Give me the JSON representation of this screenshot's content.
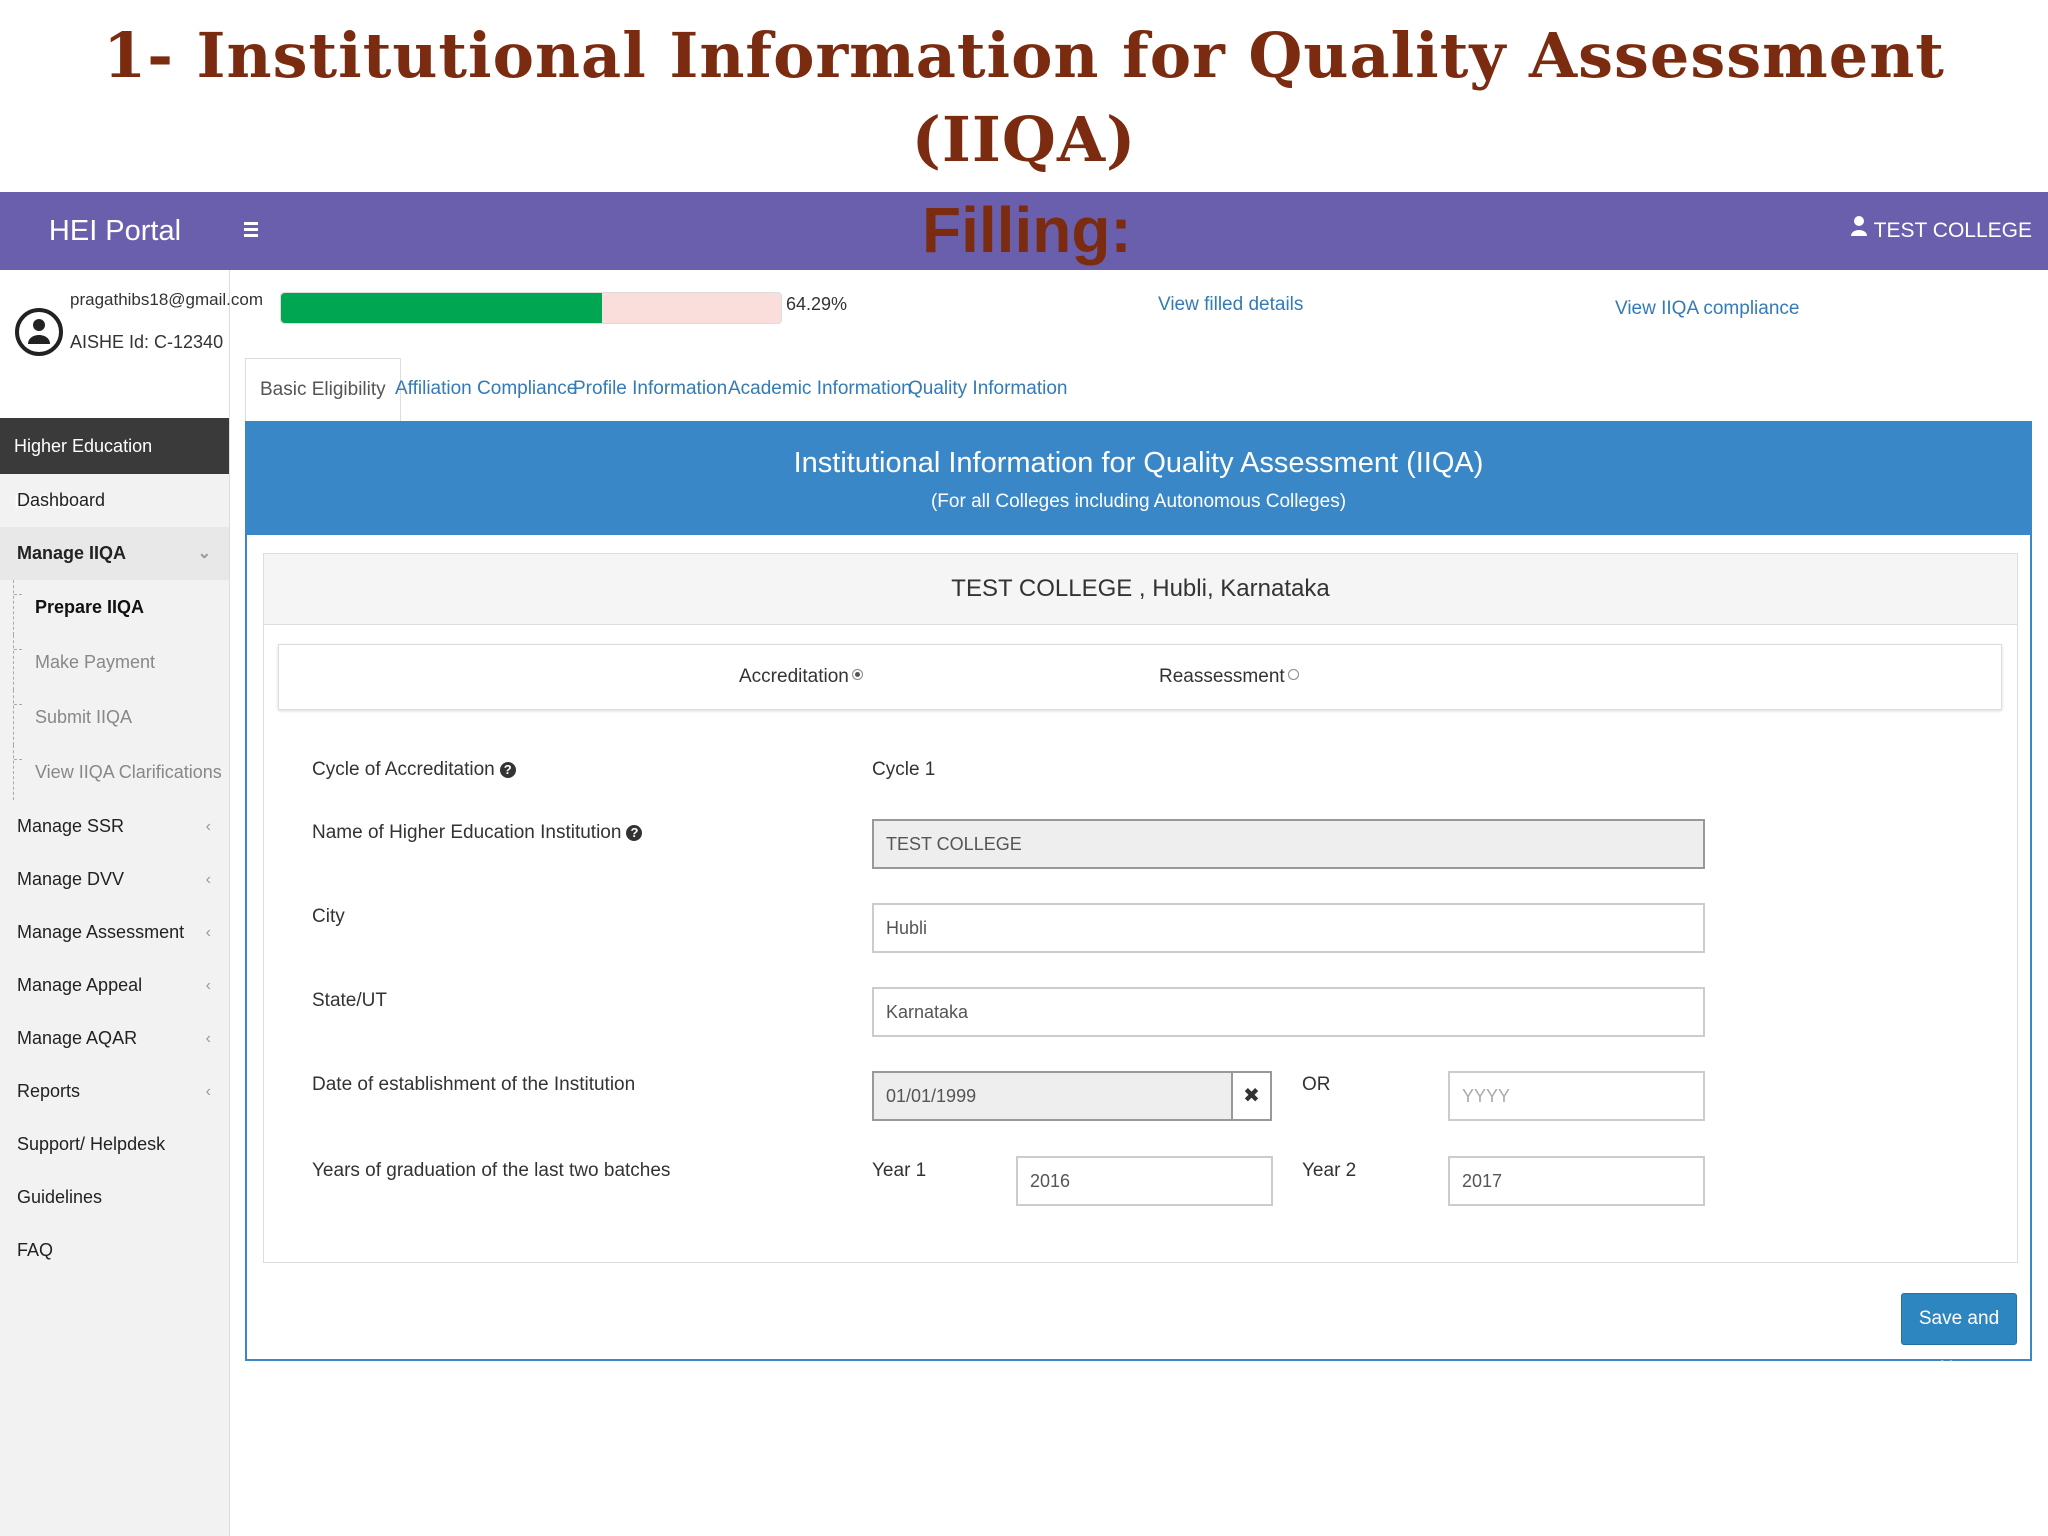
{
  "slide": {
    "title": "1- Institutional Information for Quality Assessment (IIQA)",
    "subtitle": "Filling:"
  },
  "topbar": {
    "brand": "HEI Portal",
    "menu_icon": "hamburger-icon",
    "user_label": "TEST COLLEGE",
    "user_icon": "user-icon",
    "bar_color": "#6a5fad"
  },
  "profile": {
    "email": "pragathibs18@gmail.com",
    "aishe": "AISHE Id: C-12340"
  },
  "sidebar": {
    "section": "Higher Education Institution",
    "items": [
      {
        "label": "Dashboard",
        "caret": ""
      },
      {
        "label": "Manage IIQA",
        "caret": "⌄"
      },
      {
        "label": "Manage SSR",
        "caret": "‹"
      },
      {
        "label": "Manage DVV",
        "caret": "‹"
      },
      {
        "label": "Manage Assessment",
        "caret": "‹"
      },
      {
        "label": "Manage Appeal",
        "caret": "‹"
      },
      {
        "label": "Manage AQAR",
        "caret": "‹"
      },
      {
        "label": "Reports",
        "caret": "‹"
      },
      {
        "label": "Support/ Helpdesk",
        "caret": ""
      },
      {
        "label": "Guidelines",
        "caret": ""
      },
      {
        "label": "FAQ",
        "caret": ""
      }
    ],
    "subitems": [
      {
        "label": "Prepare IIQA"
      },
      {
        "label": "Make Payment"
      },
      {
        "label": "Submit IIQA"
      },
      {
        "label": "View IIQA Clarifications"
      }
    ]
  },
  "progress": {
    "percent": 64.29,
    "label": "64.29%",
    "fill_color": "#00a651"
  },
  "links": {
    "view_filled": "View filled details",
    "view_compliance": "View IIQA compliance"
  },
  "tabs": [
    {
      "label": "Basic Eligibility"
    },
    {
      "label": "Affiliation Compliance"
    },
    {
      "label": "Profile Information"
    },
    {
      "label": "Academic Information"
    },
    {
      "label": "Quality Information"
    }
  ],
  "panel": {
    "heading": "Institutional Information for Quality Assessment (IIQA)",
    "subheading": "(For all Colleges including Autonomous Colleges)",
    "college": "TEST COLLEGE , Hubli, Karnataka",
    "header_color": "#3a87c8"
  },
  "assessment": {
    "accreditation": "Accreditation",
    "reassessment": "Reassessment",
    "selected": "Accreditation"
  },
  "form": {
    "cycle_label": "Cycle of Accreditation",
    "cycle_value": "Cycle 1",
    "name_label": "Name of Higher Education Institution",
    "name_value": "TEST COLLEGE",
    "city_label": "City",
    "city_value": "Hubli",
    "state_label": "State/UT",
    "state_value": "Karnataka",
    "date_label": "Date of establishment of the Institution",
    "date_value": "01/01/1999",
    "or_label": "OR",
    "year_placeholder": "YYYY",
    "grad_label": "Years of graduation of the last two batches",
    "year1_label": "Year 1",
    "year1_value": "2016",
    "year2_label": "Year 2",
    "year2_value": "2017"
  },
  "actions": {
    "save_next": "Save and Next"
  }
}
